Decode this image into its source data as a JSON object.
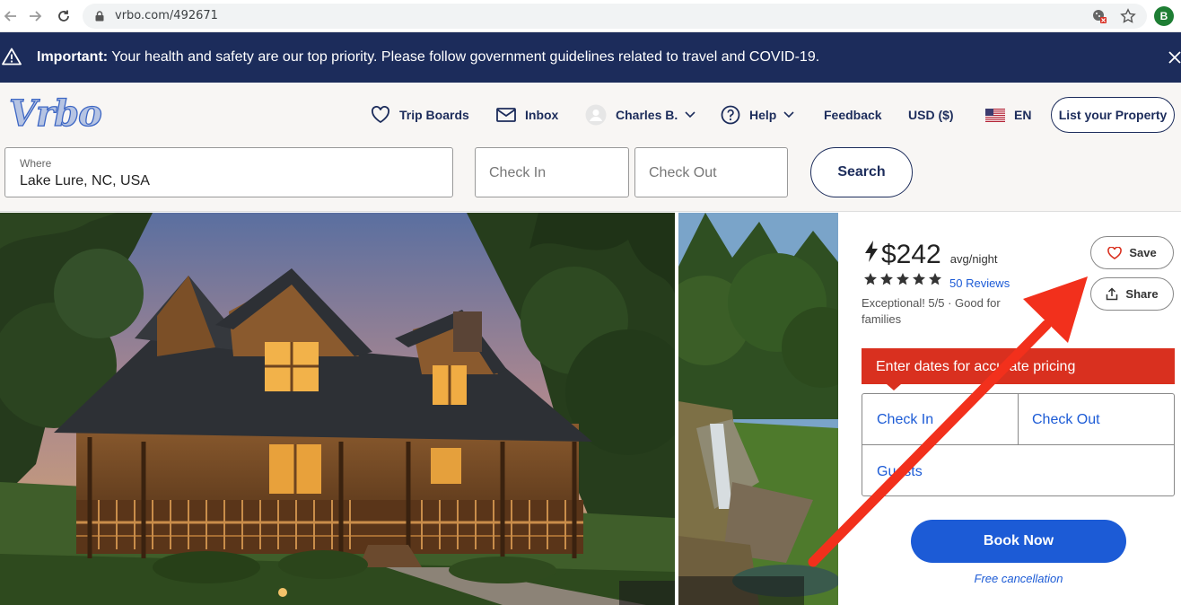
{
  "browser": {
    "url": "vrbo.com/492671",
    "profile_initial": "B"
  },
  "banner": {
    "important_label": "Important:",
    "message": " Your health and safety are our top priority. Please follow government guidelines related to travel and COVID-19."
  },
  "header": {
    "logo_text": "Vrbo",
    "nav": {
      "trip_boards": "Trip Boards",
      "inbox": "Inbox",
      "user": "Charles B.",
      "help": "Help",
      "feedback": "Feedback",
      "currency": "USD ($)",
      "language": "EN",
      "list_property": "List your Property"
    }
  },
  "search": {
    "where_label": "Where",
    "where_value": "Lake Lure, NC, USA",
    "check_in_placeholder": "Check In",
    "check_out_placeholder": "Check Out",
    "search_label": "Search"
  },
  "listing": {
    "price": "$242",
    "price_unit": "avg/night",
    "star_count": 5,
    "reviews": "50 Reviews",
    "rating_text": "Exceptional! 5/5 · Good for families",
    "save_label": "Save",
    "share_label": "Share",
    "alert_text": "Enter dates for accurate pricing",
    "check_in": "Check In",
    "check_out": "Check Out",
    "guests": "Guests",
    "book_label": "Book Now",
    "free_cancellation": "Free cancellation"
  },
  "colors": {
    "brand_navy": "#1c2c5b",
    "link_blue": "#1c5bd6",
    "alert_red": "#d9301f",
    "annotation_arrow": "#f2301c"
  }
}
